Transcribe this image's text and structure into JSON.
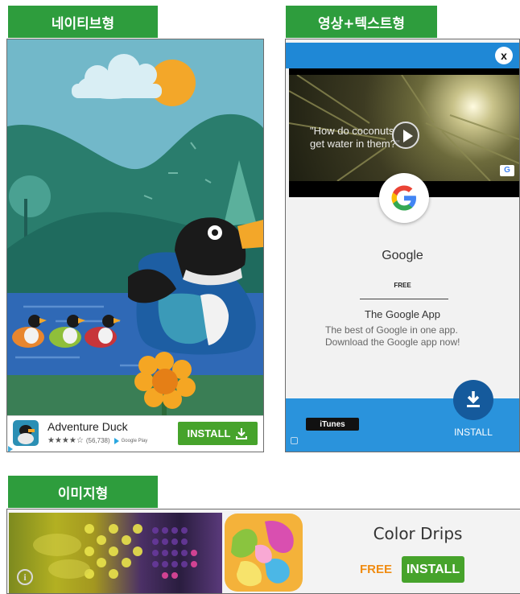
{
  "section_native": {
    "label": "네이티브형"
  },
  "section_video": {
    "label": "영상+텍스트형"
  },
  "section_image": {
    "label": "이미지형"
  },
  "native_ad": {
    "app_name": "Adventure Duck",
    "rating_stars": "★★★★☆",
    "review_count": "(56,738)",
    "store_label": "Google Play",
    "install_label": "INSTALL",
    "icons": [
      "duck-app-icon",
      "download-icon",
      "ad-choices-icon",
      "google-play-icon"
    ]
  },
  "video_ad": {
    "close_label": "x",
    "video_caption_line1": "\"How do coconuts",
    "video_caption_line2": "get water in them?\"",
    "app_title": "Google",
    "price": "FREE",
    "app_fullname": "The Google App",
    "description": "The best of Google in one app. Download the Google app now!",
    "store_badge": "iTunes",
    "install_label": "INSTALL",
    "brand_colors": {
      "header": "#1f88d6",
      "footer": "#2a93dc",
      "install_circle": "#155a9c"
    }
  },
  "image_ad": {
    "app_title": "Color Drips",
    "price": "FREE",
    "install_label": "INSTALL",
    "price_color": "#f08c12",
    "icons": [
      "info-icon",
      "color-drips-app-icon"
    ]
  }
}
